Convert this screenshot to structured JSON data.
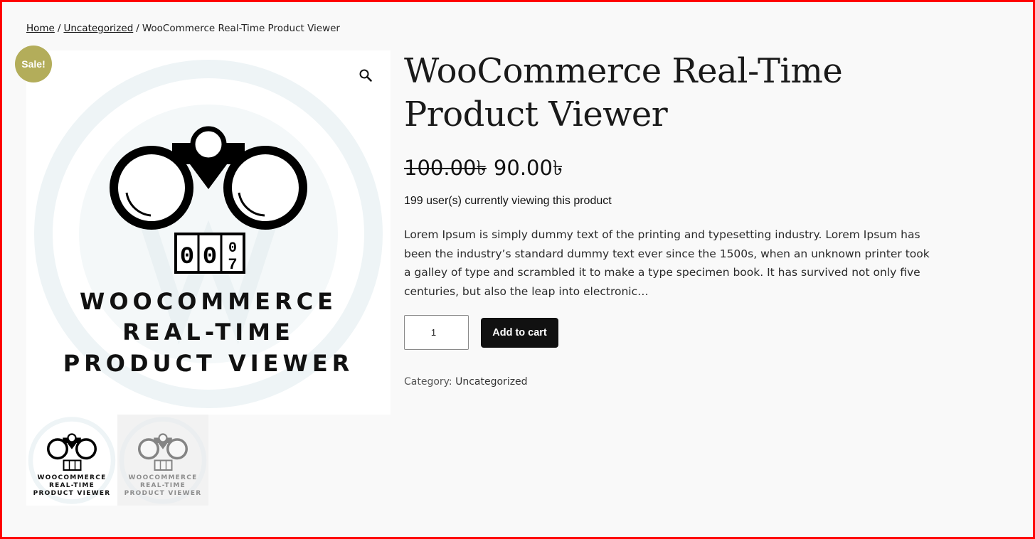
{
  "breadcrumb": {
    "home": "Home",
    "separator": "/",
    "category": "Uncategorized",
    "current": "WooCommerce Real-Time Product Viewer"
  },
  "gallery": {
    "sale_badge": "Sale!",
    "zoom_icon": "magnifier-icon",
    "image_text": {
      "counter": [
        "0",
        "0",
        "0",
        "7"
      ],
      "line1": "WOOCOMMERCE",
      "line2": "REAL-TIME",
      "line3": "PRODUCT VIEWER"
    },
    "thumbnails": [
      {
        "name": "thumbnail-1"
      },
      {
        "name": "thumbnail-2"
      }
    ]
  },
  "product": {
    "title": "WooCommerce Real-Time Product Viewer",
    "regular_price": "100.00৳",
    "sale_price": "90.00৳",
    "viewers_text": "199 user(s) currently viewing this product",
    "description": "Lorem Ipsum is simply dummy text of the printing and typesetting industry. Lorem Ipsum has been the industry’s standard dummy text ever since the 1500s, when an unknown printer took a galley of type and scrambled it to make a type specimen book. It has survived not only five centuries, but also the leap into electronic…",
    "quantity": "1",
    "add_to_cart": "Add to cart",
    "category_label": "Category:",
    "category_value": "Uncategorized"
  },
  "colors": {
    "frame": "#ff0000",
    "sale_badge": "#b3ad5a",
    "button": "#111111",
    "background": "#f9f9f9"
  }
}
